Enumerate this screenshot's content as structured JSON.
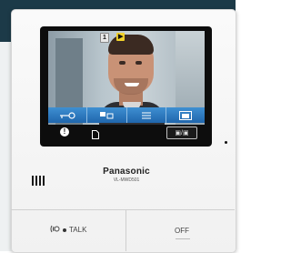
{
  "screen_overlay": {
    "camera_label": "1",
    "record_label": "▶"
  },
  "function_buttons": [
    {
      "icon": "key-icon"
    },
    {
      "icon": "camera-switch-icon"
    },
    {
      "icon": "menu-icon"
    },
    {
      "icon": "picture-icon"
    }
  ],
  "screen_bottom": {
    "info_label": "!",
    "switch_label": "▣/▣"
  },
  "device": {
    "brand": "Panasonic",
    "model": "VL-MWD501"
  },
  "buttons": {
    "talk_label": "TALK",
    "off_label": "OFF"
  },
  "colors": {
    "function_bar": "#2a77c0",
    "body": "#f5f5f5"
  }
}
